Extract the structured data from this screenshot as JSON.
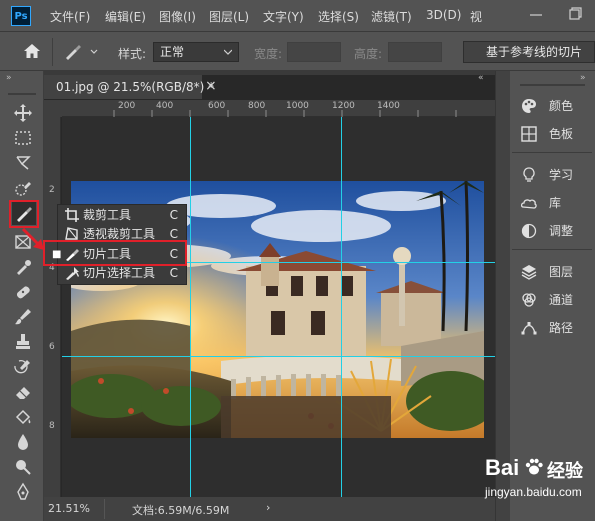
{
  "menubar": {
    "logo": "Ps",
    "items": [
      "文件(F)",
      "编辑(E)",
      "图像(I)",
      "图层(L)",
      "文字(Y)",
      "选择(S)",
      "滤镜(T)",
      "3D(D)",
      "视"
    ]
  },
  "options": {
    "style_label": "样式:",
    "style_value": "正常",
    "width_label": "宽度:",
    "height_label": "高度:",
    "slices_from_guides": "基于参考线的切片"
  },
  "document": {
    "tab_title": "01.jpg @ 21.5%(RGB/8*) *",
    "close": "×",
    "ruler_h_labels": [
      "200",
      "400",
      "600",
      "800",
      "1000",
      "1200",
      "1400"
    ],
    "ruler_v_labels": [
      "2",
      "4",
      "6",
      "8"
    ],
    "zoom": "21.51%",
    "doc_info": "文档:6.59M/6.59M",
    "status_arrow": "›"
  },
  "flyout": {
    "items": [
      {
        "label": "裁剪工具",
        "key": "C"
      },
      {
        "label": "透视裁剪工具",
        "key": "C"
      },
      {
        "label": "切片工具",
        "key": "C",
        "active": true
      },
      {
        "label": "切片选择工具",
        "key": "C"
      }
    ]
  },
  "panels": {
    "group1": [
      {
        "label": "颜色",
        "icon": "palette-icon"
      },
      {
        "label": "色板",
        "icon": "swatches-icon"
      }
    ],
    "group2": [
      {
        "label": "学习",
        "icon": "lightbulb-icon"
      },
      {
        "label": "库",
        "icon": "libraries-icon"
      },
      {
        "label": "调整",
        "icon": "adjustments-icon"
      }
    ],
    "group3": [
      {
        "label": "图层",
        "icon": "layers-icon"
      },
      {
        "label": "通道",
        "icon": "channels-icon"
      },
      {
        "label": "路径",
        "icon": "paths-icon"
      }
    ]
  },
  "watermark": {
    "brand": "Bai",
    "brand2": "经验",
    "url": "jingyan.baidu.com"
  },
  "colors": {
    "guide": "#23d0e6",
    "highlight": "#e0202a",
    "panel_bg": "#535353"
  }
}
